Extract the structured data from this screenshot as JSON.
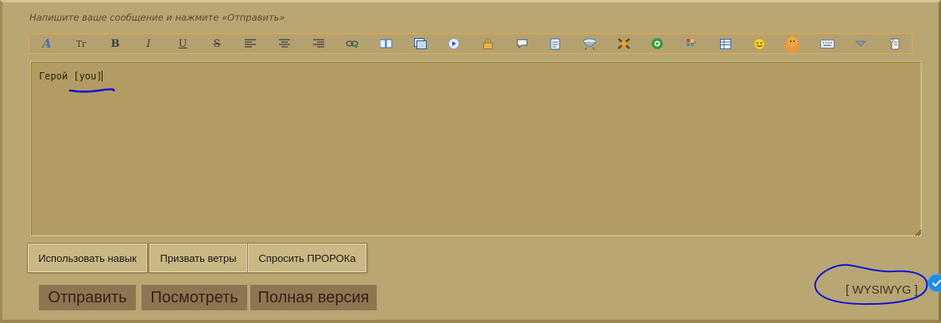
{
  "hint_text": "Напишите ваше сообщение и нажмите «Отправить»",
  "toolbar": {
    "buttons": [
      {
        "name": "font-face-icon",
        "label": "A"
      },
      {
        "name": "font-size-icon",
        "label": "Tr"
      },
      {
        "name": "bold-icon",
        "label": "B"
      },
      {
        "name": "italic-icon",
        "label": "I"
      },
      {
        "name": "underline-icon",
        "label": "U"
      },
      {
        "name": "strikethrough-icon",
        "label": "S"
      },
      {
        "name": "align-left-icon"
      },
      {
        "name": "align-center-icon"
      },
      {
        "name": "align-right-icon"
      },
      {
        "name": "link-icon"
      },
      {
        "name": "book-icon"
      },
      {
        "name": "image-icon"
      },
      {
        "name": "media-play-icon"
      },
      {
        "name": "lock-icon"
      },
      {
        "name": "quote-bubble-icon"
      },
      {
        "name": "document-icon"
      },
      {
        "name": "cauldron-icon"
      },
      {
        "name": "crossed-swords-icon"
      },
      {
        "name": "gear-icon"
      },
      {
        "name": "color-palette-icon"
      },
      {
        "name": "table-icon"
      },
      {
        "name": "smiley-icon"
      },
      {
        "name": "cat-icon"
      },
      {
        "name": "keyboard-icon"
      },
      {
        "name": "dropdown-arrow-icon"
      },
      {
        "name": "scroll-icon"
      }
    ]
  },
  "editor": {
    "content": "Герой [you]"
  },
  "skill_buttons": {
    "use_skill": "Использовать навык",
    "summon_winds": "Призвать ветры",
    "ask_prophet": "Спросить ПРОРОКа"
  },
  "actions": {
    "send": "Отправить",
    "preview": "Посмотреть",
    "full_version": "Полная версия"
  },
  "wysiwyg_toggle": "[ WYSIWYG ]",
  "colors": {
    "background": "#b8a673",
    "editor_bg": "#b39c63",
    "main_button_bg": "#8b7652",
    "main_button_text": "#3b1f14",
    "annotation_blue": "#1010d8",
    "check_badge": "#1f8ce8"
  }
}
